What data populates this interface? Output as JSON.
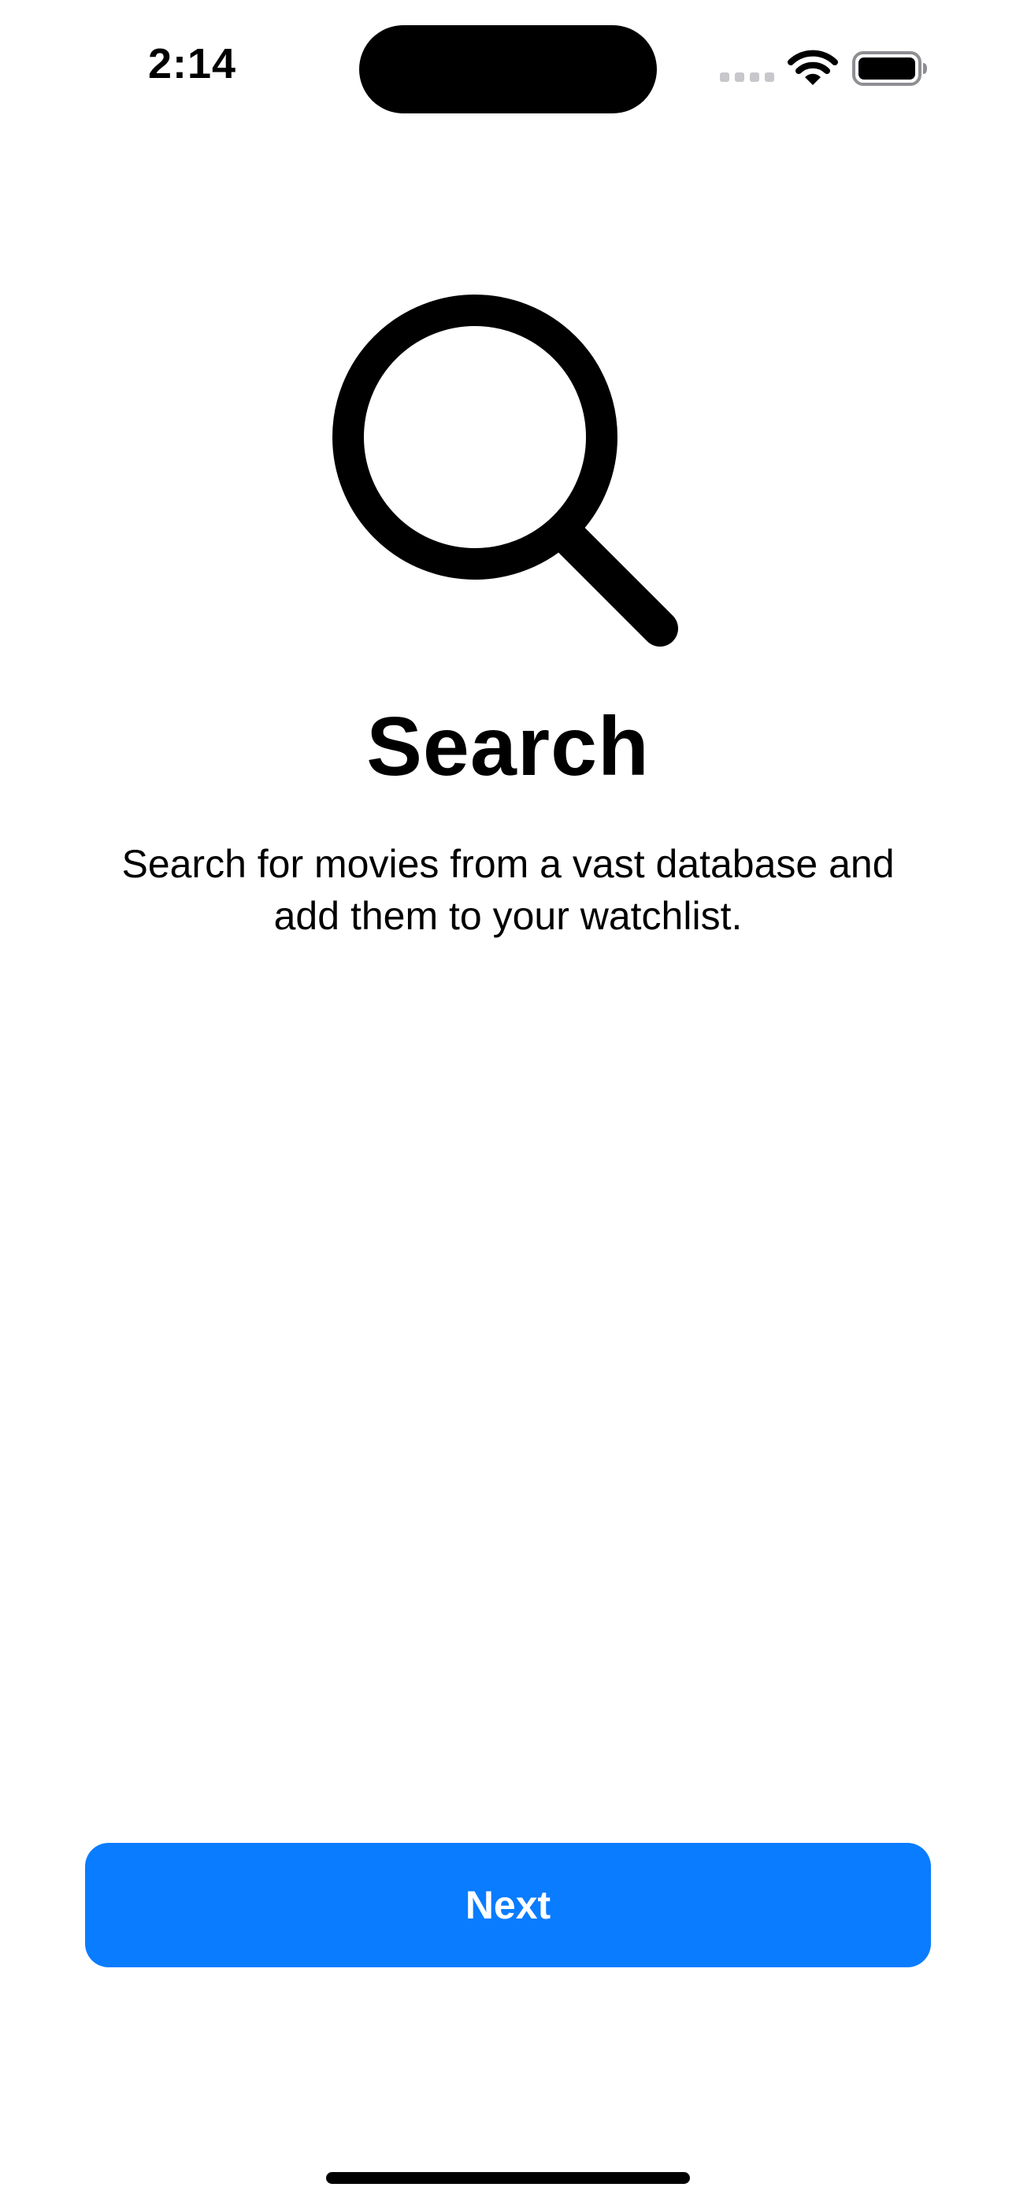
{
  "status_bar": {
    "time": "2:14",
    "icons": [
      "cellular-signal-icon",
      "wifi-icon",
      "battery-icon"
    ]
  },
  "onboarding": {
    "icon": "magnifying-glass-icon",
    "title": "Search",
    "description": "Search for movies from a vast database and add them to your watchlist."
  },
  "actions": {
    "next_label": "Next"
  },
  "colors": {
    "accent": "#0a7cff",
    "text": "#000000",
    "background": "#ffffff",
    "inactive_signal": "#c7c7cc"
  }
}
